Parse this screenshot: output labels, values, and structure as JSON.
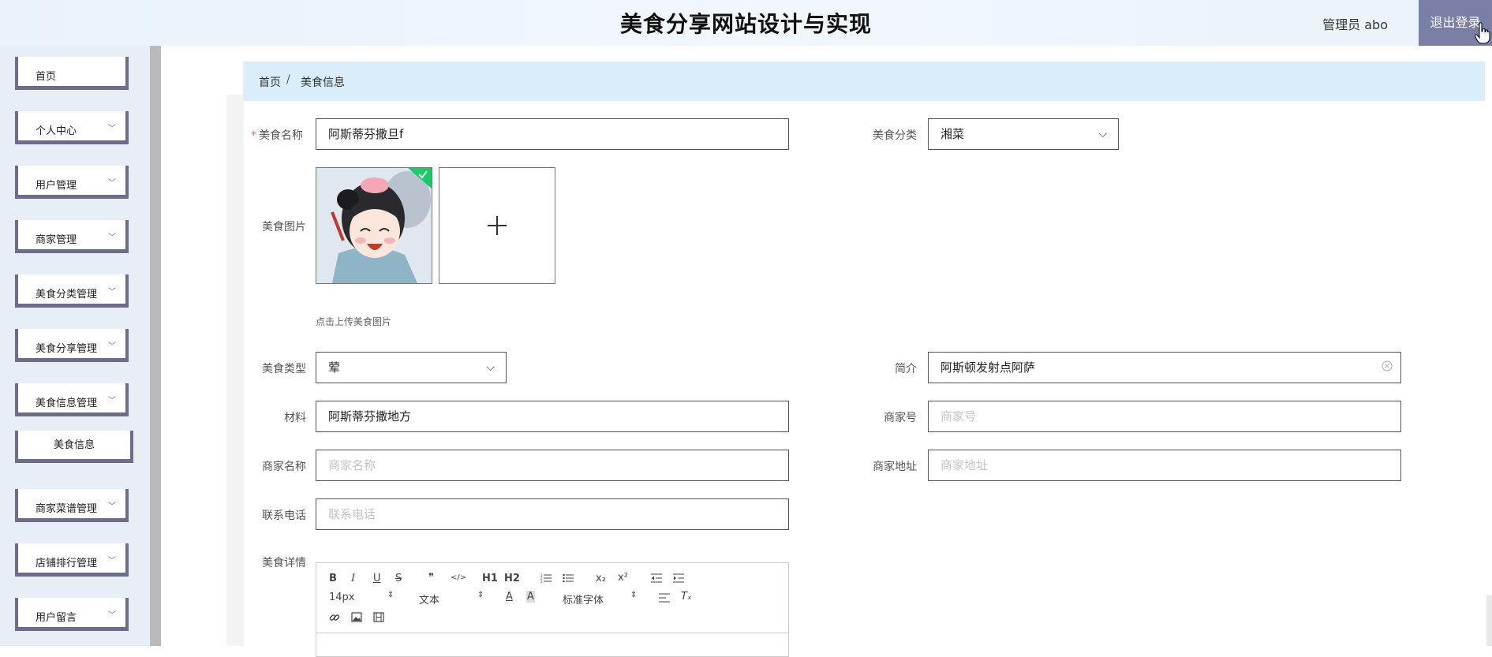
{
  "header": {
    "title": "美食分享网站设计与实现",
    "admin": "管理员 abo",
    "logout": "退出登录"
  },
  "sidebar": {
    "items": [
      {
        "label": "首页"
      },
      {
        "label": "个人中心"
      },
      {
        "label": "用户管理"
      },
      {
        "label": "商家管理"
      },
      {
        "label": "美食分类管理"
      },
      {
        "label": "美食分享管理"
      },
      {
        "label": "美食信息管理"
      },
      {
        "label": "美食信息"
      },
      {
        "label": "商家菜谱管理"
      },
      {
        "label": "店铺排行管理"
      },
      {
        "label": "用户留言"
      }
    ]
  },
  "breadcrumb": {
    "home": "首页",
    "separator": "/",
    "current": "美食信息"
  },
  "form": {
    "name_label": "美食名称",
    "name_value": "阿斯蒂芬撒旦f",
    "category_label": "美食分类",
    "category_value": "湘菜",
    "image_label": "美食图片",
    "upload_tip": "点击上传美食图片",
    "type_label": "美食类型",
    "type_value": "荤",
    "intro_label": "简介",
    "intro_value": "阿斯顿发射点阿萨",
    "material_label": "材料",
    "material_value": "阿斯蒂芬撒地方",
    "merchant_no_label": "商家号",
    "merchant_no_placeholder": "商家号",
    "merchant_name_label": "商家名称",
    "merchant_name_placeholder": "商家名称",
    "merchant_addr_label": "商家地址",
    "merchant_addr_placeholder": "商家地址",
    "phone_label": "联系电话",
    "phone_placeholder": "联系电话",
    "detail_label": "美食详情"
  },
  "editor": {
    "bold": "B",
    "italic": "I",
    "underline": "U",
    "strike": "S",
    "quote": "❞",
    "code": "</>",
    "h1": "H1",
    "h2": "H2",
    "sub": "x₂",
    "sup": "x²",
    "font_size": "14px",
    "text_style": "文本",
    "font_family": "标准字体"
  },
  "colors": {
    "accent": "#7a7fa6",
    "breadcrumb_bg": "#d9eefa",
    "sidebar_border": "#6d6c8c"
  }
}
